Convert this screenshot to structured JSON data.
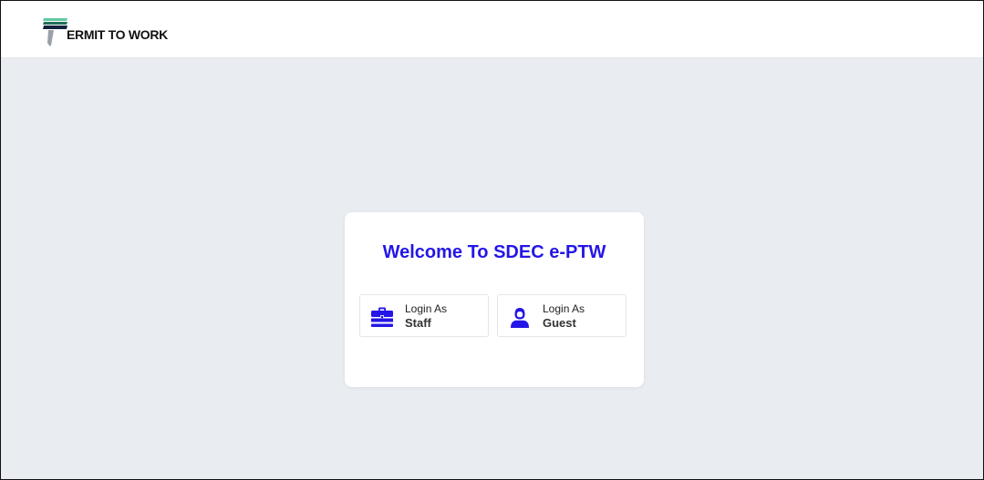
{
  "header": {
    "logo_text": "ERMIT TO WORK"
  },
  "card": {
    "title": "Welcome To SDEC e-PTW",
    "staff_button": {
      "prefix": "Login As",
      "role": "Staff",
      "icon": "briefcase-icon"
    },
    "guest_button": {
      "prefix": "Login As",
      "role": "Guest",
      "icon": "user-icon"
    }
  },
  "colors": {
    "accent": "#2416e6",
    "background": "#e9ecf1",
    "logo_green_light": "#63c9a0",
    "logo_green_dark": "#1f6f5a",
    "logo_navy": "#14243f"
  }
}
